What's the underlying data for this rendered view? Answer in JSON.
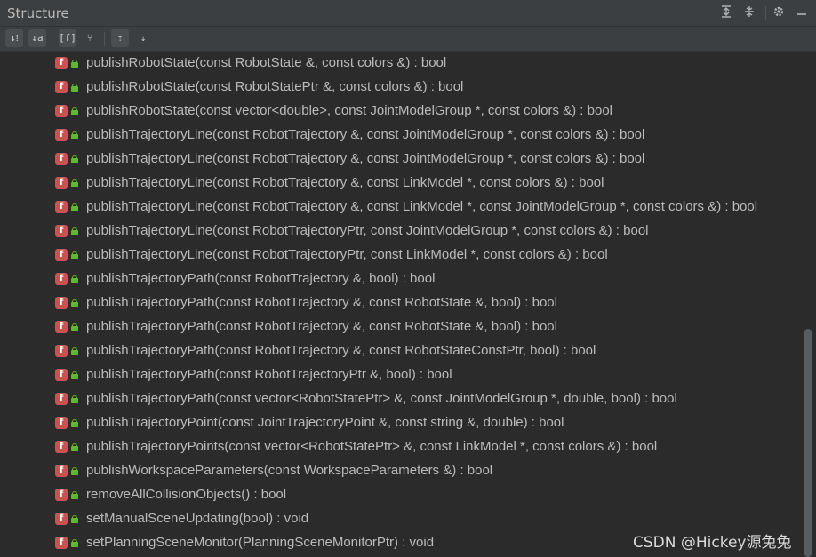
{
  "panel": {
    "title": "Structure",
    "header_icons": [
      "expand-all-icon",
      "collapse-all-icon",
      "gear-icon",
      "minimize-icon"
    ]
  },
  "toolbar": {
    "buttons": [
      {
        "name": "sort-by-visibility-button",
        "glyph": "↓⁞"
      },
      {
        "name": "sort-alphabetically-button",
        "glyph": "↓a"
      },
      {
        "name": "show-fields-button",
        "glyph": "[f]"
      },
      {
        "name": "show-inherited-button",
        "glyph": "⑂"
      },
      {
        "name": "autoscroll-to-source-button",
        "glyph": "⇡"
      },
      {
        "name": "autoscroll-from-source-button",
        "glyph": "⇣"
      }
    ]
  },
  "items": [
    "publishRobotState(const RobotState &, const colors &) : bool",
    "publishRobotState(const RobotStatePtr &, const colors &) : bool",
    "publishRobotState(const vector<double>, const JointModelGroup *, const colors &) : bool",
    "publishTrajectoryLine(const RobotTrajectory &, const JointModelGroup *, const colors &) : bool",
    "publishTrajectoryLine(const RobotTrajectory &, const JointModelGroup *, const colors &) : bool",
    "publishTrajectoryLine(const RobotTrajectory &, const LinkModel *, const colors &) : bool",
    "publishTrajectoryLine(const RobotTrajectory &, const LinkModel *, const JointModelGroup *, const colors &) : bool",
    "publishTrajectoryLine(const RobotTrajectoryPtr, const JointModelGroup *, const colors &) : bool",
    "publishTrajectoryLine(const RobotTrajectoryPtr, const LinkModel *, const colors &) : bool",
    "publishTrajectoryPath(const RobotTrajectory &, bool) : bool",
    "publishTrajectoryPath(const RobotTrajectory &, const RobotState &, bool) : bool",
    "publishTrajectoryPath(const RobotTrajectory &, const RobotState &, bool) : bool",
    "publishTrajectoryPath(const RobotTrajectory &, const RobotStateConstPtr, bool) : bool",
    "publishTrajectoryPath(const RobotTrajectoryPtr &, bool) : bool",
    "publishTrajectoryPath(const vector<RobotStatePtr> &, const JointModelGroup *, double, bool) : bool",
    "publishTrajectoryPoint(const JointTrajectoryPoint &, const string &, double) : bool",
    "publishTrajectoryPoints(const vector<RobotStatePtr> &, const LinkModel *, const colors &) : bool",
    "publishWorkspaceParameters(const WorkspaceParameters &) : bool",
    "removeAllCollisionObjects() : bool",
    "setManualSceneUpdating(bool) : void",
    "setPlanningSceneMonitor(PlanningSceneMonitorPtr) : void"
  ],
  "method_icon_letter": "f",
  "watermark": "CSDN @Hickey源兔兔",
  "colors": {
    "background": "#2b2b2b",
    "header": "#3c3f41",
    "method_icon": "#c75450",
    "public_lock": "#5fb832",
    "text": "#bbbbbb"
  }
}
